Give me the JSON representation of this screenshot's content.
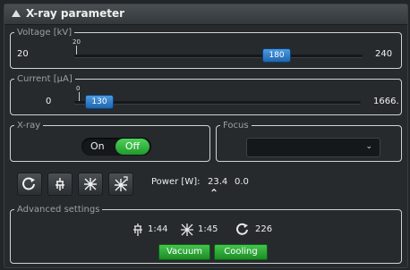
{
  "title": "X-ray parameter",
  "voltage": {
    "legend": "Voltage [kV]",
    "min": "20",
    "max": "240",
    "value": "180",
    "min_marker": "20"
  },
  "current": {
    "legend": "Current [µA]",
    "min": "0",
    "max": "1666.",
    "value": "130",
    "min_marker": "0"
  },
  "xray": {
    "legend": "X-ray",
    "on_label": "On",
    "off_label": "Off"
  },
  "focus": {
    "legend": "Focus",
    "selected": ""
  },
  "power": {
    "label": "Power [W]:",
    "value": "23.4",
    "value2": "0.0"
  },
  "advanced": {
    "legend": "Advanced settings",
    "time1": "1:44",
    "time2": "1:45",
    "count": "226",
    "vacuum_label": "Vacuum",
    "cooling_label": "Cooling"
  },
  "colors": {
    "accent_blue": "#2f7fd0",
    "active_green": "#2fb83a",
    "background": "#262a2d"
  }
}
